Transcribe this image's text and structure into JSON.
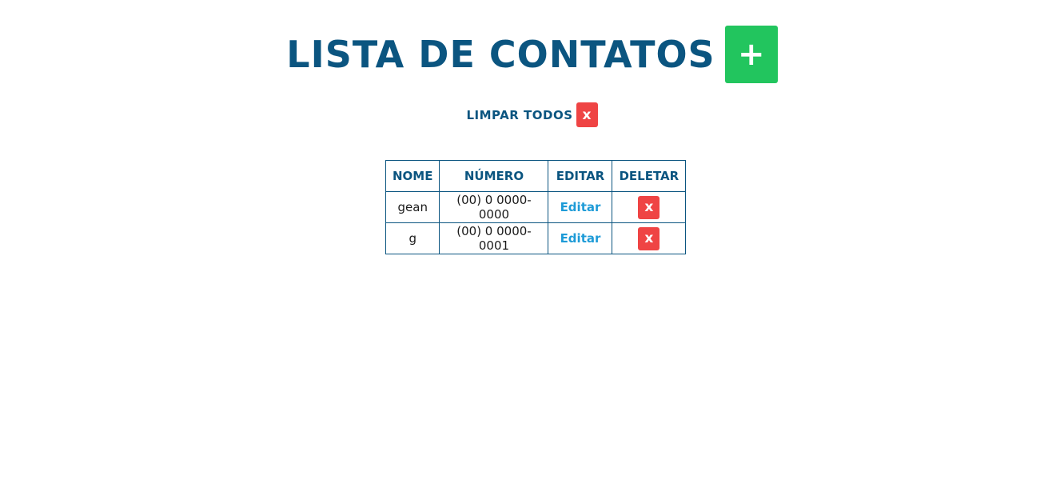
{
  "header": {
    "title": "LISTA DE CONTATOS",
    "add_label": "+"
  },
  "clear_all": {
    "label": "LIMPAR TODOS",
    "button_label": "x"
  },
  "table": {
    "columns": [
      "NOME",
      "NÚMERO",
      "EDITAR",
      "DELETAR"
    ],
    "rows": [
      {
        "nome": "gean",
        "numero": "(00) 0 0000-0000",
        "edit_label": "Editar",
        "delete_label": "x"
      },
      {
        "nome": "g",
        "numero": "(00) 0 0000-0001",
        "edit_label": "Editar",
        "delete_label": "x"
      }
    ]
  },
  "colors": {
    "primary": "#0b5580",
    "add": "#22c55e",
    "delete": "#ef4444",
    "link": "#1e9bd7"
  }
}
